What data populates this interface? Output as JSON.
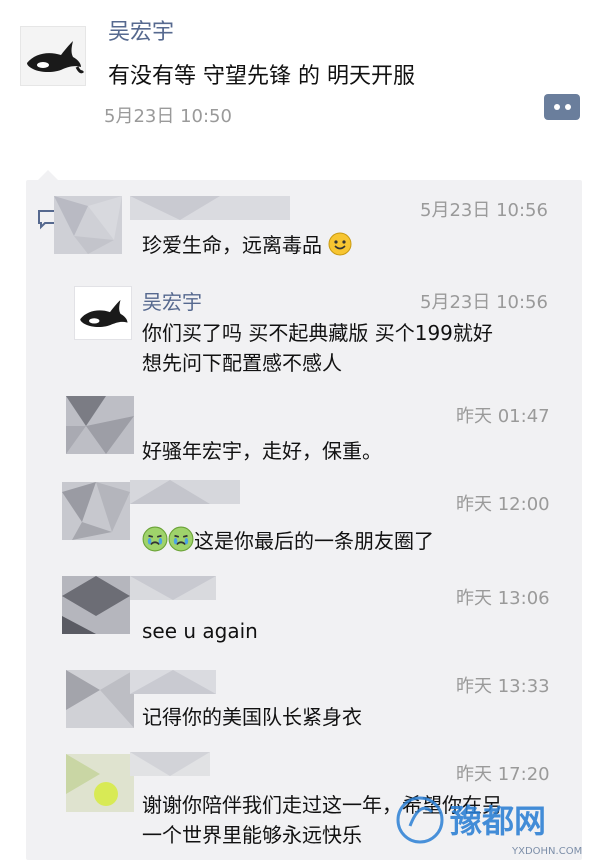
{
  "post": {
    "author": "吴宏宇",
    "text": "有没有等 守望先锋 的 明天开服",
    "time": "5月23日 10:50",
    "more_icon": "more-dots-icon",
    "avatar_icon": "orca-avatar"
  },
  "comments": [
    {
      "name": "",
      "time": "5月23日 10:56",
      "text": "珍爱生命，远离毒品",
      "emoji": "smile-emoji"
    },
    {
      "name": "吴宏宇",
      "time": "5月23日 10:56",
      "lines": [
        "你们买了吗 买不起典藏版 买个199就好",
        "想先问下配置感不感人"
      ]
    },
    {
      "name": "",
      "time": "昨天 01:47",
      "text": "好骚年宏宇，走好，保重。"
    },
    {
      "name": "",
      "time": "昨天 12:00",
      "text": "这是你最后的一条朋友圈了",
      "emoji": "crying-emoji"
    },
    {
      "name": "",
      "time": "昨天 13:06",
      "text": "see u again"
    },
    {
      "name": "",
      "time": "昨天 13:33",
      "text": "记得你的美国队长紧身衣"
    },
    {
      "name": "",
      "time": "昨天 17:20",
      "lines": [
        "谢谢你陪伴我们走过这一年，希望你在另",
        "一个世界里能够永远快乐"
      ]
    }
  ],
  "watermark": {
    "brand": "豫都网",
    "url": "YXDOHN.COM"
  },
  "colors": {
    "name_blue": "#56698f",
    "time_gray": "#9a9a9a",
    "panel": "#f1f1f3"
  }
}
